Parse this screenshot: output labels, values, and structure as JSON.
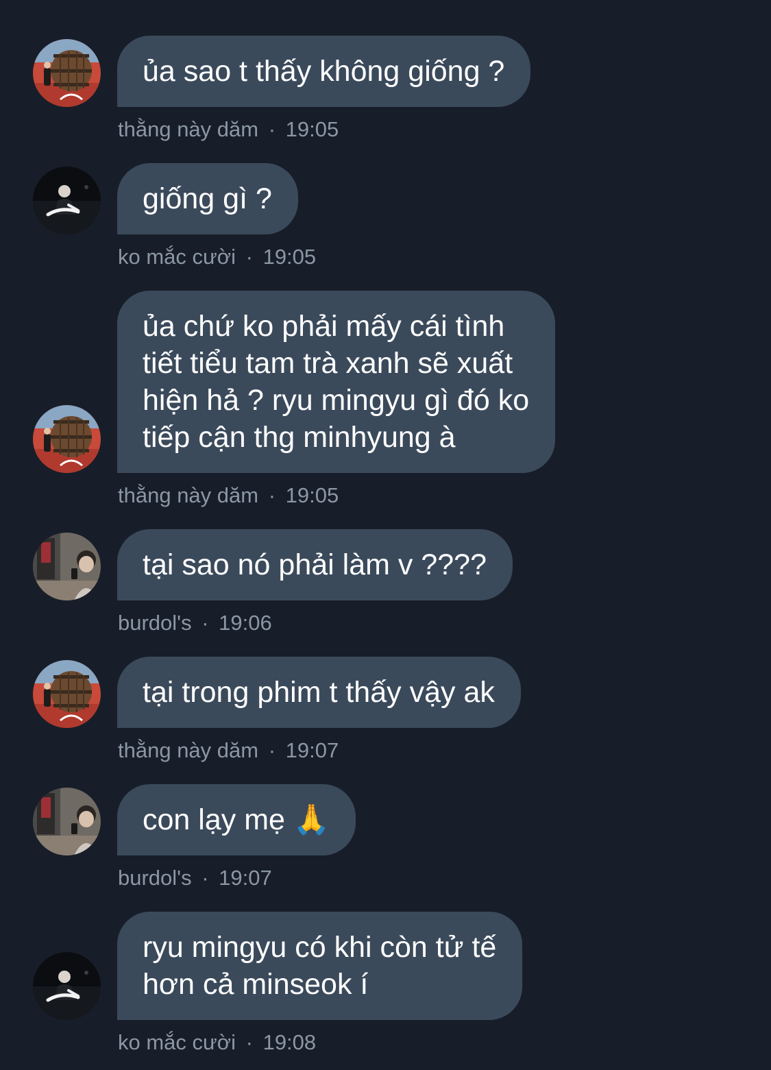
{
  "messages": [
    {
      "text": "ủa sao t thấy không giống ?",
      "sender": "thằng này dăm",
      "time": "19:05",
      "avatar_icon": "barrel-avatar-icon"
    },
    {
      "text": "giống gì ?",
      "sender": "ko mắc cười",
      "time": "19:05",
      "avatar_icon": "dark-portrait-avatar-icon"
    },
    {
      "text": "ủa chứ ko phải mấy cái tình\ntiết tiểu tam trà xanh sẽ xuất\nhiện hả ? ryu mingyu gì đó ko\ntiếp cận thg minhyung à",
      "sender": "thằng này dăm",
      "time": "19:05",
      "avatar_icon": "barrel-avatar-icon"
    },
    {
      "text": "tại sao nó phải làm v ????",
      "sender": "burdol's",
      "time": "19:06",
      "avatar_icon": "mirror-selfie-avatar-icon"
    },
    {
      "text": "tại trong phim t thấy vậy ak",
      "sender": "thằng này dăm",
      "time": "19:07",
      "avatar_icon": "barrel-avatar-icon"
    },
    {
      "text": "con lạy mẹ 🙏",
      "sender": "burdol's",
      "time": "19:07",
      "avatar_icon": "mirror-selfie-avatar-icon"
    },
    {
      "text": "ryu mingyu có khi còn tử tế\nhơn cả minseok í",
      "sender": "ko mắc cười",
      "time": "19:08",
      "avatar_icon": "dark-portrait-avatar-icon"
    }
  ],
  "meta_separator": "·",
  "colors": {
    "background": "#171e29",
    "bubble": "#3b4a5b",
    "bubble_text": "#ffffff",
    "meta_text": "#8c97a5"
  }
}
